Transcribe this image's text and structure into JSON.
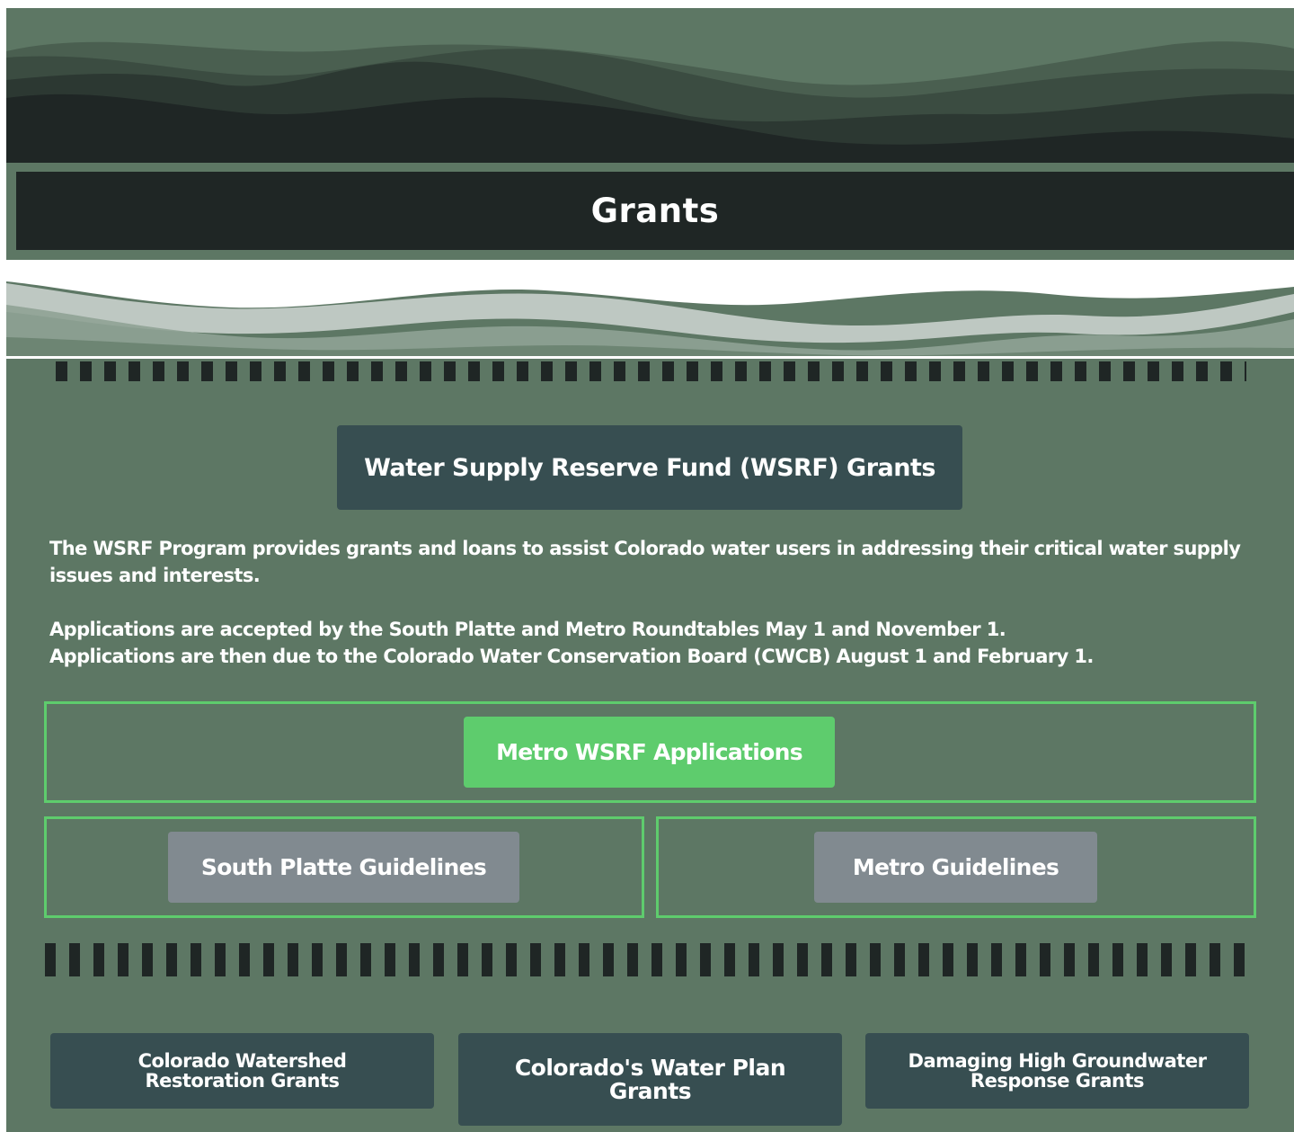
{
  "header": {
    "title": "Grants"
  },
  "wsrf": {
    "heading": "Water Supply Reserve Fund (WSRF) Grants",
    "intro_1": "The WSRF Program provides grants and loans to assist Colorado water users in addressing their critical water supply issues and interests.",
    "intro_2_line1": "Applications are accepted by the South Platte and Metro Roundtables May 1 and November 1.",
    "intro_2_line2": "Applications are then due to the Colorado Water Conservation Board (CWCB) August 1 and February 1.",
    "applications_button": "Metro WSRF Applications",
    "south_platte_button": "South Platte Guidelines",
    "metro_guidelines_button": "Metro Guidelines"
  },
  "other_grants": [
    {
      "line1": "Colorado Watershed",
      "line2": "Restoration Grants"
    },
    {
      "line1": "Colorado's Water Plan",
      "line2": "Grants"
    },
    {
      "line1": "Damaging High Groundwater",
      "line2": "Response Grants"
    }
  ],
  "colors": {
    "background": "#5d7764",
    "title_bar": "#1f2625",
    "panel": "#374e51",
    "accent_green": "#5ecc6d",
    "secondary_button": "#818a90"
  }
}
